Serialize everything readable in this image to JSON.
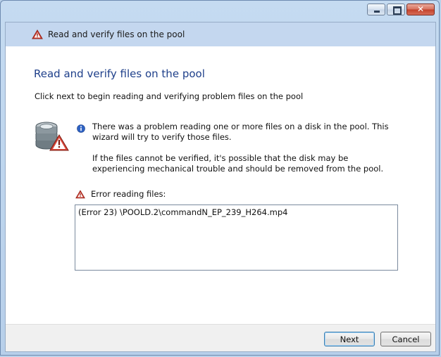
{
  "window": {
    "title": "Read and verify files on the pool",
    "controls": {
      "minimize": "minimize",
      "maximize": "maximize",
      "close": "✕"
    }
  },
  "page": {
    "heading": "Read and verify files on the pool",
    "instruction": "Click next to begin reading and verifying problem files on the pool",
    "info_paragraph_1": "There was a problem reading one or more files on a disk in the pool. This wizard will try to verify those files.",
    "info_paragraph_2": "If the files cannot be verified, it's possible that the disk may be experiencing mechanical trouble and should be removed from the pool.",
    "error_label": "Error reading files:",
    "error_files": [
      "(Error 23) \\POOLD.2\\commandN_EP_239_H264.mp4"
    ]
  },
  "buttons": {
    "next": "Next",
    "cancel": "Cancel"
  },
  "icons": {
    "header": "warning-icon",
    "disk": "disk-warning-icon",
    "info": "info-icon",
    "error": "warning-icon"
  },
  "colors": {
    "heading": "#1e3f8a",
    "warning": "#c0392b",
    "info": "#2f63c4"
  }
}
